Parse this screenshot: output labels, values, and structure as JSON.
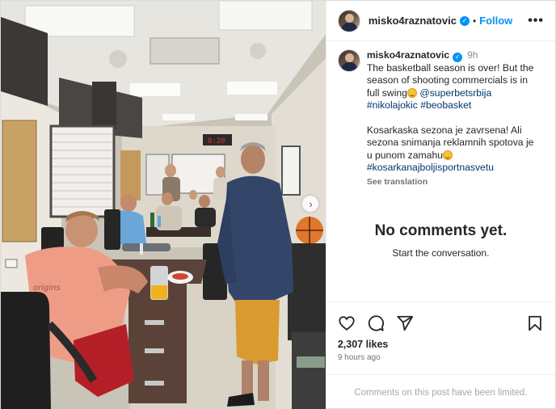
{
  "post": {
    "username": "misko4raznatovic",
    "follow_label": "Follow",
    "more_label": "•••",
    "time_ago": "9h",
    "caption_line1": "The basketball season is over! But the season of shooting commercials is in full swing",
    "mention": "@superbetsrbija",
    "hashtags1": "#nikolajokic #beobasket",
    "caption_line2": "Kosarkaska sezona je zavrsena! Ali sezona snimanja reklamnih spotova je u punom zamahu",
    "hashtags2": "#kosarkanajboljisportnasvetu",
    "see_translation": "See translation",
    "no_comments_title": "No comments yet.",
    "no_comments_sub": "Start the conversation.",
    "likes": "2,307 likes",
    "posted_ago": "9 hours ago",
    "comments_limited": "Comments on this post have been limited.",
    "next_label": "›"
  },
  "icons": {
    "like": "heart-icon",
    "comment": "comment-icon",
    "share": "paper-plane-icon",
    "save": "bookmark-icon",
    "verified": "verified-badge-icon"
  },
  "colors": {
    "accent": "#0095f6",
    "link": "#00376b",
    "muted": "#737373"
  }
}
